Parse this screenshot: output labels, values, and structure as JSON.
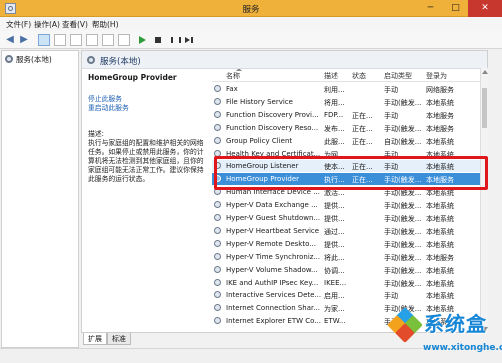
{
  "window": {
    "title": "服务",
    "min_glyph": "─",
    "max_glyph": "□",
    "close_glyph": "✕"
  },
  "menu": [
    "文件(F)",
    "操作(A)",
    "查看(V)",
    "帮助(H)"
  ],
  "toolbar": {
    "back": "◀",
    "forward": "▶"
  },
  "tree": {
    "root_label": "服务(本地)"
  },
  "main": {
    "title": "服务(本地)",
    "selected_service": "HomeGroup Provider",
    "stop_link": "停止此服务",
    "restart_link": "重启动此服务",
    "desc_label": "描述:",
    "desc_text": "执行与家庭组的配置和维护相关的网络任务。如果停止或禁用此服务，你的计算机将无法检测到其他家庭组，且你的家庭组可能无法正常工作。建议你保持此服务的运行状态。"
  },
  "columns": {
    "name": "名称",
    "desc": "描述",
    "status": "状态",
    "startup": "启动类型",
    "logon": "登录为"
  },
  "rows": [
    {
      "name": "Fax",
      "desc": "利用...",
      "status": "",
      "startup": "手动",
      "logon": "网络服务"
    },
    {
      "name": "File History Service",
      "desc": "将用...",
      "status": "",
      "startup": "手动(触发...",
      "logon": "本地系统"
    },
    {
      "name": "Function Discovery Provi...",
      "desc": "FDP...",
      "status": "正在...",
      "startup": "手动",
      "logon": "本地服务"
    },
    {
      "name": "Function Discovery Reso...",
      "desc": "发布...",
      "status": "正在...",
      "startup": "手动(触发...",
      "logon": "本地服务"
    },
    {
      "name": "Group Policy Client",
      "desc": "此服...",
      "status": "正在...",
      "startup": "自动(触发...",
      "logon": "本地系统"
    },
    {
      "name": "Health Key and Certificat...",
      "desc": "为网...",
      "status": "",
      "startup": "手动",
      "logon": "本地系统"
    },
    {
      "name": "HomeGroup Listener",
      "desc": "使本...",
      "status": "正在...",
      "startup": "手动",
      "logon": "本地系统"
    },
    {
      "name": "HomeGroup Provider",
      "desc": "执行...",
      "status": "正在...",
      "startup": "手动(触发...",
      "logon": "本地服务"
    },
    {
      "name": "Human Interface Device ...",
      "desc": "激活...",
      "status": "",
      "startup": "手动(触发...",
      "logon": "本地系统"
    },
    {
      "name": "Hyper-V Data Exchange ...",
      "desc": "提供...",
      "status": "",
      "startup": "手动(触发...",
      "logon": "本地系统"
    },
    {
      "name": "Hyper-V Guest Shutdown...",
      "desc": "提供...",
      "status": "",
      "startup": "手动(触发...",
      "logon": "本地系统"
    },
    {
      "name": "Hyper-V Heartbeat Service",
      "desc": "通过...",
      "status": "",
      "startup": "手动(触发...",
      "logon": "本地系统"
    },
    {
      "name": "Hyper-V Remote Deskto...",
      "desc": "提供...",
      "status": "",
      "startup": "手动(触发...",
      "logon": "本地系统"
    },
    {
      "name": "Hyper-V Time Synchroniz...",
      "desc": "将此...",
      "status": "",
      "startup": "手动(触发...",
      "logon": "本地服务"
    },
    {
      "name": "Hyper-V Volume Shadow...",
      "desc": "协调...",
      "status": "",
      "startup": "手动(触发...",
      "logon": "本地系统"
    },
    {
      "name": "IKE and AuthIP IPsec Key...",
      "desc": "IKEE...",
      "status": "",
      "startup": "手动(触发...",
      "logon": "本地系统"
    },
    {
      "name": "Interactive Services Dete...",
      "desc": "启用...",
      "status": "",
      "startup": "手动",
      "logon": "本地系统"
    },
    {
      "name": "Internet Connection Shar...",
      "desc": "为家...",
      "status": "",
      "startup": "手动(触发...",
      "logon": "本地系统"
    },
    {
      "name": "Internet Explorer ETW Co...",
      "desc": "ETW...",
      "status": "",
      "startup": "手动",
      "logon": "本地系统"
    }
  ],
  "tabs": [
    "扩展",
    "标准"
  ],
  "watermark": {
    "title": "系统盒",
    "url": "www.xitonghe.com"
  },
  "colors": {
    "titlebar": "#f0b13a",
    "selection": "#3b8fd9",
    "highlight_box": "#e0161d",
    "brand": "#1686d6"
  }
}
